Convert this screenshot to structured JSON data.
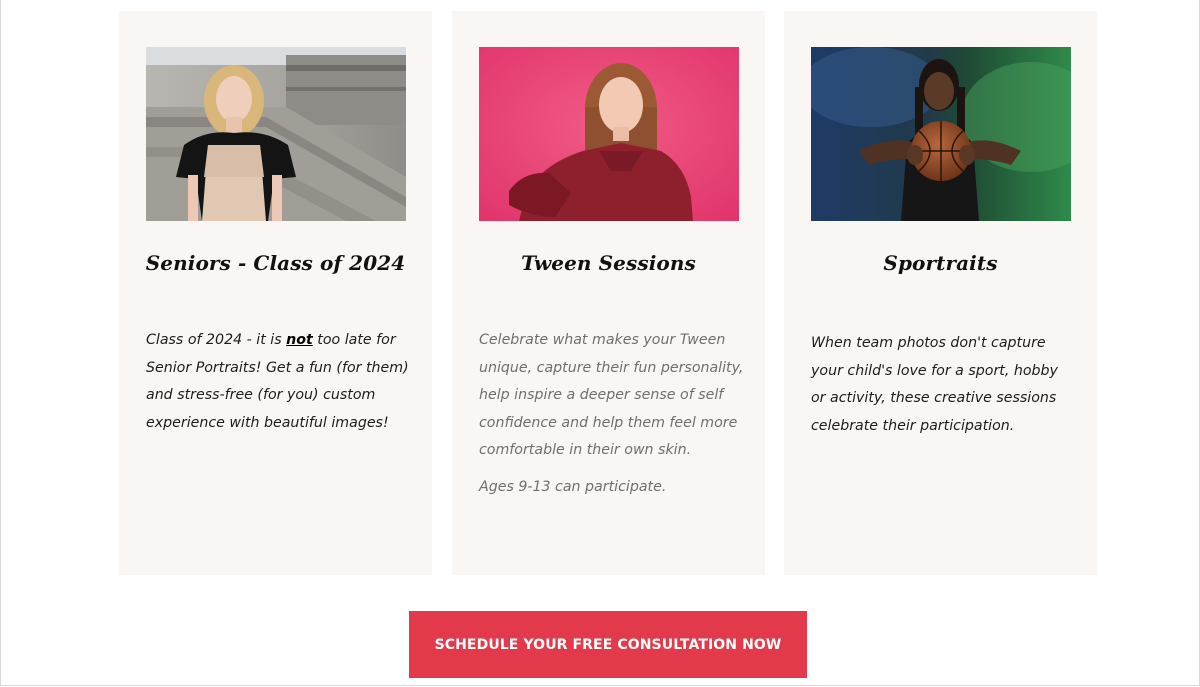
{
  "cards": [
    {
      "title": "Seniors - Class of 2024",
      "photo_alt": "senior-portrait-photo",
      "body_parts": [
        "Class of 2024 - it is ",
        "not",
        " too late for Senior Portraits! Get a fun (for them) and stress-free (for you) custom experience with beautiful images!"
      ]
    },
    {
      "title": "Tween Sessions",
      "photo_alt": "tween-portrait-photo",
      "body_paragraphs": [
        "Celebrate what makes your Tween unique, capture their fun personality, help inspire a deeper sense of self confidence and help them feel more comfortable in their own skin.",
        "Ages 9-13 can participate."
      ]
    },
    {
      "title": "Sportraits",
      "photo_alt": "sports-portrait-photo",
      "body_paragraphs": [
        "When team photos don't capture your child's love for a sport, hobby or activity, these creative sessions celebrate their participation."
      ]
    }
  ],
  "cta": {
    "label": "SCHEDULE YOUR FREE CONSULTATION NOW"
  },
  "colors": {
    "card_background": "#faf6f3",
    "cta_background": "#e23a4a",
    "cta_text": "#ffffff"
  }
}
